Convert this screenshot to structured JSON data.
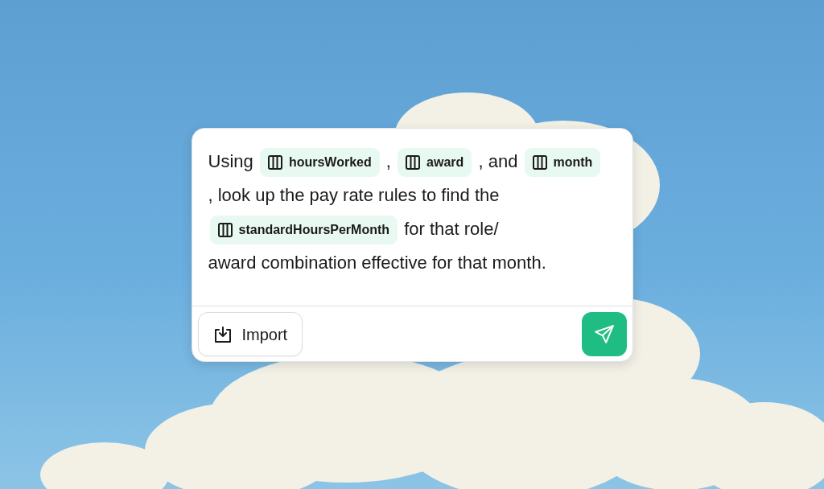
{
  "prompt": {
    "segments": [
      {
        "kind": "text",
        "text": "Using"
      },
      {
        "kind": "column",
        "text": "hoursWorked"
      },
      {
        "kind": "text",
        "text": ","
      },
      {
        "kind": "column",
        "text": "award"
      },
      {
        "kind": "text",
        "text": ", and"
      },
      {
        "kind": "column",
        "text": "month"
      },
      {
        "kind": "text",
        "text": ", look up the pay rate rules to find"
      },
      {
        "kind": "text",
        "text": "the"
      },
      {
        "kind": "column",
        "text": "standardHoursPerMonth"
      },
      {
        "kind": "text",
        "text": "for that role/"
      },
      {
        "kind": "text",
        "text": "award combination effective for that month."
      }
    ]
  },
  "import_button": {
    "label": "Import"
  }
}
